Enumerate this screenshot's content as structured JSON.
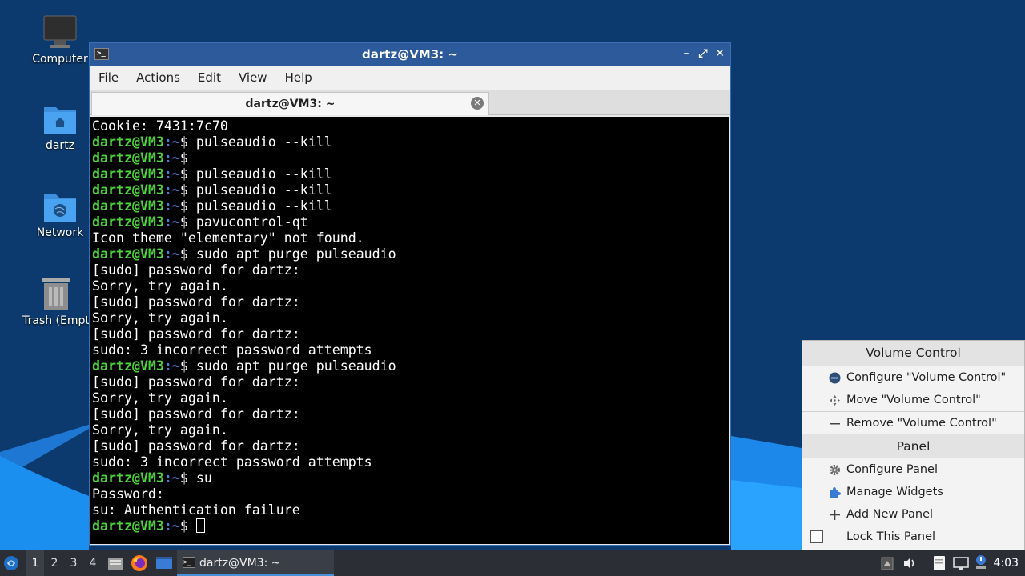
{
  "desktop": {
    "icons": [
      {
        "name": "computer",
        "label": "Computer"
      },
      {
        "name": "home-folder",
        "label": "dartz"
      },
      {
        "name": "network",
        "label": "Network"
      },
      {
        "name": "trash",
        "label": "Trash (Empt"
      }
    ]
  },
  "window": {
    "title": "dartz@VM3: ~",
    "menu": [
      "File",
      "Actions",
      "Edit",
      "View",
      "Help"
    ],
    "tab_label": "dartz@VM3: ~",
    "minimize_glyph": "–",
    "maximize_glyph": "⤢",
    "close_glyph": "✕",
    "tab_close_glyph": "✕"
  },
  "terminal": {
    "prompt_user": "dartz@VM3",
    "prompt_path": ":~",
    "prompt_suffix": "$ ",
    "lines": [
      {
        "type": "out",
        "text": "Cookie: 7431:7c70"
      },
      {
        "type": "cmd",
        "text": "pulseaudio --kill"
      },
      {
        "type": "cmd",
        "text": ""
      },
      {
        "type": "cmd",
        "text": "pulseaudio --kill"
      },
      {
        "type": "cmd",
        "text": "pulseaudio --kill"
      },
      {
        "type": "cmd",
        "text": "pulseaudio --kill"
      },
      {
        "type": "cmd",
        "text": "pavucontrol-qt"
      },
      {
        "type": "out",
        "text": "Icon theme \"elementary\" not found."
      },
      {
        "type": "cmd",
        "text": "sudo apt purge pulseaudio"
      },
      {
        "type": "out",
        "text": "[sudo] password for dartz:"
      },
      {
        "type": "out",
        "text": "Sorry, try again."
      },
      {
        "type": "out",
        "text": "[sudo] password for dartz:"
      },
      {
        "type": "out",
        "text": "Sorry, try again."
      },
      {
        "type": "out",
        "text": "[sudo] password for dartz:"
      },
      {
        "type": "out",
        "text": "sudo: 3 incorrect password attempts"
      },
      {
        "type": "cmd",
        "text": "sudo apt purge pulseaudio"
      },
      {
        "type": "out",
        "text": "[sudo] password for dartz:"
      },
      {
        "type": "out",
        "text": "Sorry, try again."
      },
      {
        "type": "out",
        "text": "[sudo] password for dartz:"
      },
      {
        "type": "out",
        "text": "Sorry, try again."
      },
      {
        "type": "out",
        "text": "[sudo] password for dartz:"
      },
      {
        "type": "out",
        "text": "sudo: 3 incorrect password attempts"
      },
      {
        "type": "cmd",
        "text": "su"
      },
      {
        "type": "out",
        "text": "Password:"
      },
      {
        "type": "out",
        "text": "su: Authentication failure"
      },
      {
        "type": "cmd_cursor",
        "text": ""
      }
    ]
  },
  "context_menu": {
    "header1": "Volume Control",
    "configure_volume": "Configure \"Volume Control\"",
    "move_volume": "Move \"Volume Control\"",
    "remove_volume": "Remove \"Volume Control\"",
    "header2": "Panel",
    "configure_panel": "Configure Panel",
    "manage_widgets": "Manage Widgets",
    "add_panel": "Add New Panel",
    "lock_panel": "Lock This Panel"
  },
  "taskbar": {
    "workspaces": [
      "1",
      "2",
      "3",
      "4"
    ],
    "active_workspace": "1",
    "window_button": "dartz@VM3: ~",
    "clock": "4:03"
  }
}
